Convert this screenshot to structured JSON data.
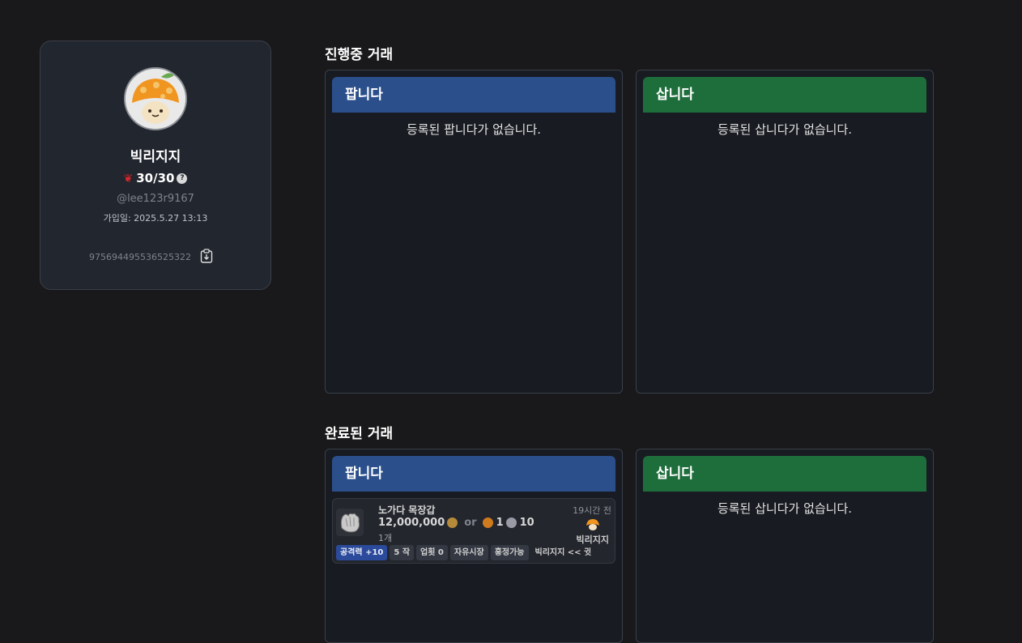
{
  "profile": {
    "username": "빅리지지",
    "rating": "30/30",
    "help": "?",
    "handle": "@lee123r9167",
    "joined": "가입일: 2025.5.27 13:13",
    "discord_id": "975694495536525322"
  },
  "ongoing": {
    "title": "진행중 거래",
    "sell": {
      "header": "팝니다",
      "empty": "등록된 팝니다가 없습니다."
    },
    "buy": {
      "header": "삽니다",
      "empty": "등록된 삽니다가 없습니다."
    }
  },
  "completed": {
    "title": "완료된 거래",
    "sell": {
      "header": "팝니다",
      "items": [
        {
          "name": "노가다 목장갑",
          "price": "12,000,000",
          "or": "or",
          "alt_price_1": "1",
          "alt_price_2": "10",
          "qty": "1개",
          "time": "19시간 전",
          "seller": "빅리지지",
          "tags": [
            "공격력 +10",
            "5 작",
            "업횟 0",
            "자유시장",
            "흥정가능",
            "빅리지지 << 귓"
          ]
        }
      ]
    },
    "buy": {
      "header": "삽니다",
      "empty": "등록된 삽니다가 없습니다."
    }
  }
}
